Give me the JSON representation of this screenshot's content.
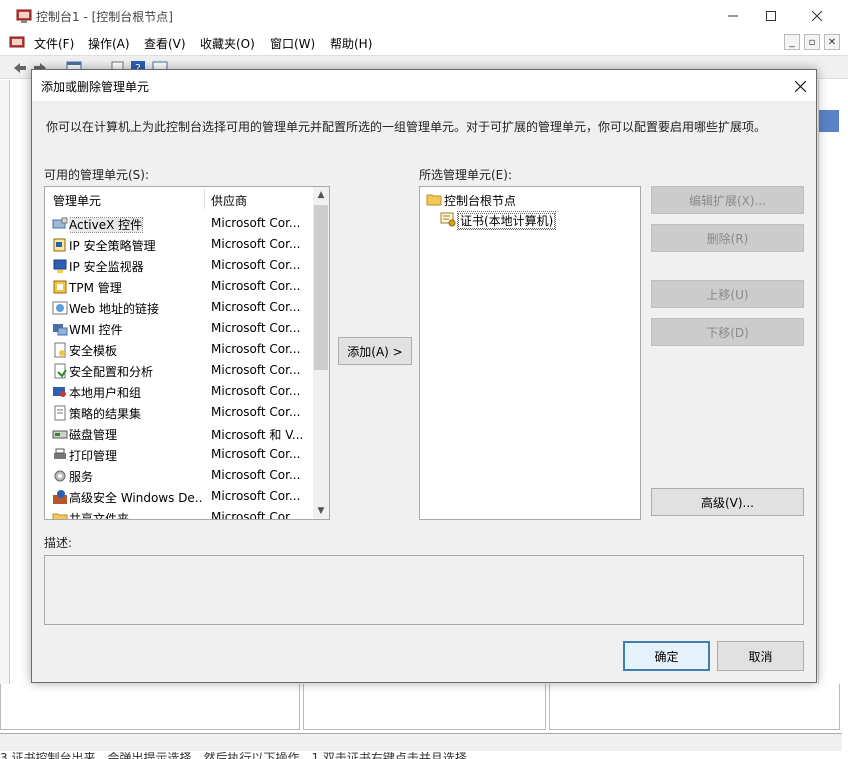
{
  "mmc": {
    "title": "控制台1 - [控制台根节点]",
    "menu": [
      "文件(F)",
      "操作(A)",
      "查看(V)",
      "收藏夹(O)",
      "窗口(W)",
      "帮助(H)"
    ],
    "bottom_text": "3.证书控制台出来，会弹出提示选择，然后执行以下操作，1.双击证书右键点击并且选择"
  },
  "dialog": {
    "title": "添加或删除管理单元",
    "intro": "你可以在计算机上为此控制台选择可用的管理单元并配置所选的一组管理单元。对于可扩展的管理单元，你可以配置要启用哪些扩展项。",
    "available_label": "可用的管理单元(S):",
    "available_columns": [
      "管理单元",
      "供应商"
    ],
    "available_items": [
      {
        "name": "ActiveX 控件",
        "vendor": "Microsoft Cor...",
        "icon": "activex-icon",
        "selected": true
      },
      {
        "name": "IP 安全策略管理",
        "vendor": "Microsoft Cor...",
        "icon": "ip-security-policy-icon"
      },
      {
        "name": "IP 安全监视器",
        "vendor": "Microsoft Cor...",
        "icon": "ip-security-monitor-icon"
      },
      {
        "name": "TPM 管理",
        "vendor": "Microsoft Cor...",
        "icon": "tpm-icon"
      },
      {
        "name": "Web 地址的链接",
        "vendor": "Microsoft Cor...",
        "icon": "web-link-icon"
      },
      {
        "name": "WMI 控件",
        "vendor": "Microsoft Cor...",
        "icon": "wmi-icon"
      },
      {
        "name": "安全模板",
        "vendor": "Microsoft Cor...",
        "icon": "security-template-icon"
      },
      {
        "name": "安全配置和分析",
        "vendor": "Microsoft Cor...",
        "icon": "security-config-icon"
      },
      {
        "name": "本地用户和组",
        "vendor": "Microsoft Cor...",
        "icon": "local-users-icon"
      },
      {
        "name": "策略的结果集",
        "vendor": "Microsoft Cor...",
        "icon": "rsop-icon"
      },
      {
        "name": "磁盘管理",
        "vendor": "Microsoft 和 V...",
        "icon": "disk-management-icon"
      },
      {
        "name": "打印管理",
        "vendor": "Microsoft Cor...",
        "icon": "print-management-icon"
      },
      {
        "name": "服务",
        "vendor": "Microsoft Cor...",
        "icon": "services-icon"
      },
      {
        "name": "高级安全 Windows De...",
        "vendor": "Microsoft Cor...",
        "icon": "firewall-icon"
      },
      {
        "name": "共享文件夹",
        "vendor": "Microsoft Cor...",
        "icon": "shared-folder-icon"
      }
    ],
    "add_button": "添加(A) >",
    "selected_label": "所选管理单元(E):",
    "selected_tree": {
      "root": "控制台根节点",
      "child": "证书(本地计算机)"
    },
    "buttons": {
      "edit_extensions": "编辑扩展(X)...",
      "remove": "删除(R)",
      "move_up": "上移(U)",
      "move_down": "下移(D)",
      "advanced": "高级(V)...",
      "ok": "确定",
      "cancel": "取消"
    },
    "description_label": "描述:"
  }
}
